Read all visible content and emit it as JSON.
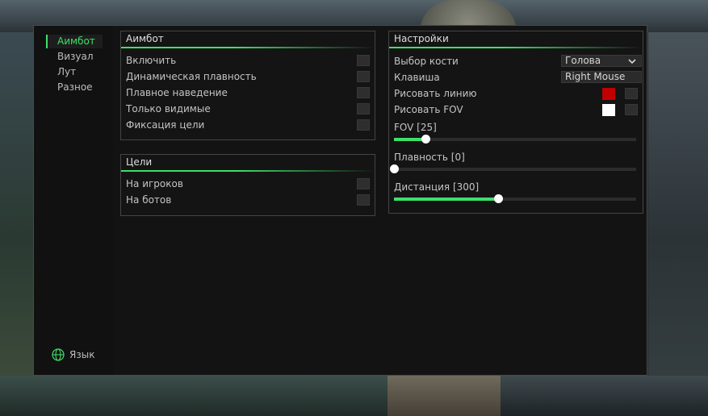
{
  "sidebar": {
    "items": [
      {
        "label": "Аимбот",
        "active": true
      },
      {
        "label": "Визуал",
        "active": false
      },
      {
        "label": "Лут",
        "active": false
      },
      {
        "label": "Разное",
        "active": false
      }
    ],
    "language_label": "Язык",
    "language_icon": "globe-icon"
  },
  "aimbot_panel": {
    "title": "Аимбот",
    "options": [
      {
        "label": "Включить",
        "checked": false
      },
      {
        "label": "Динамическая плавность",
        "checked": false
      },
      {
        "label": "Плавное наведение",
        "checked": false
      },
      {
        "label": "Только видимые",
        "checked": false
      },
      {
        "label": "Фиксация цели",
        "checked": false
      }
    ]
  },
  "targets_panel": {
    "title": "Цели",
    "options": [
      {
        "label": "На игроков",
        "checked": false
      },
      {
        "label": "На ботов",
        "checked": false
      }
    ]
  },
  "settings_panel": {
    "title": "Настройки",
    "bone": {
      "label": "Выбор кости",
      "value": "Голова"
    },
    "key": {
      "label": "Клавиша",
      "value": "Right Mouse"
    },
    "draw_line": {
      "label": "Рисовать линию",
      "color": "#c00000",
      "checked": false
    },
    "draw_fov": {
      "label": "Рисовать FOV",
      "color": "#ffffff",
      "checked": false
    },
    "fov": {
      "label": "FOV [25]",
      "value": 25,
      "fraction": 0.13
    },
    "smooth": {
      "label": "Плавность [0]",
      "value": 0,
      "fraction": 0.0
    },
    "distance": {
      "label": "Дистанция [300]",
      "value": 300,
      "fraction": 0.43
    }
  },
  "colors": {
    "accent": "#3ee06a",
    "window_bg": "#131313",
    "panel_border": "#444444"
  }
}
